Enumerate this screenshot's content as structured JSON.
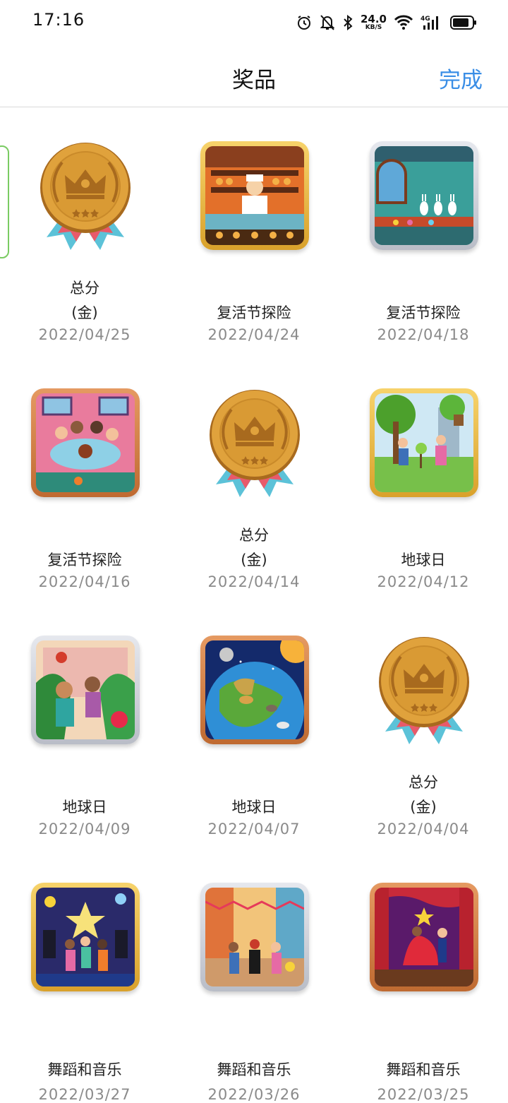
{
  "status_bar": {
    "time": "17:16",
    "speed_value": "24.0",
    "speed_unit": "KB/S",
    "network": "4G",
    "icons": [
      "alarm-icon",
      "mute-bell-icon",
      "bluetooth-icon",
      "wifi-icon",
      "signal-icon",
      "battery-icon"
    ]
  },
  "header": {
    "title": "奖品",
    "done_label": "完成",
    "accent_color": "#3a8ee6"
  },
  "rewards": [
    {
      "kind": "medal",
      "caption_lines": [
        "总分",
        "(金)"
      ],
      "date": "2022/04/25"
    },
    {
      "kind": "puzzle",
      "frame": "gold",
      "scene": "bakery",
      "caption_lines": [
        "复活节探险"
      ],
      "date": "2022/04/24"
    },
    {
      "kind": "puzzle",
      "frame": "silver",
      "scene": "bunny-factory",
      "caption_lines": [
        "复活节探险"
      ],
      "date": "2022/04/18"
    },
    {
      "kind": "puzzle",
      "frame": "bronze",
      "scene": "family-dinner",
      "caption_lines": [
        "复活节探险"
      ],
      "date": "2022/04/16"
    },
    {
      "kind": "medal",
      "caption_lines": [
        "总分",
        "(金)"
      ],
      "date": "2022/04/14"
    },
    {
      "kind": "puzzle",
      "frame": "gold",
      "scene": "tree-planting",
      "caption_lines": [
        "地球日"
      ],
      "date": "2022/04/12"
    },
    {
      "kind": "puzzle",
      "frame": "silver",
      "scene": "jungle-friends",
      "caption_lines": [
        "地球日"
      ],
      "date": "2022/04/09"
    },
    {
      "kind": "puzzle",
      "frame": "bronze",
      "scene": "earth-animals",
      "caption_lines": [
        "地球日"
      ],
      "date": "2022/04/07"
    },
    {
      "kind": "medal",
      "caption_lines": [
        "总分",
        "(金)"
      ],
      "date": "2022/04/04"
    },
    {
      "kind": "puzzle",
      "frame": "gold",
      "scene": "night-concert",
      "caption_lines": [
        "舞蹈和音乐"
      ],
      "date": "2022/03/27"
    },
    {
      "kind": "puzzle",
      "frame": "silver",
      "scene": "street-parade",
      "caption_lines": [
        "舞蹈和音乐"
      ],
      "date": "2022/03/26"
    },
    {
      "kind": "puzzle",
      "frame": "bronze",
      "scene": "stage-dance",
      "caption_lines": [
        "舞蹈和音乐"
      ],
      "date": "2022/03/25"
    }
  ]
}
